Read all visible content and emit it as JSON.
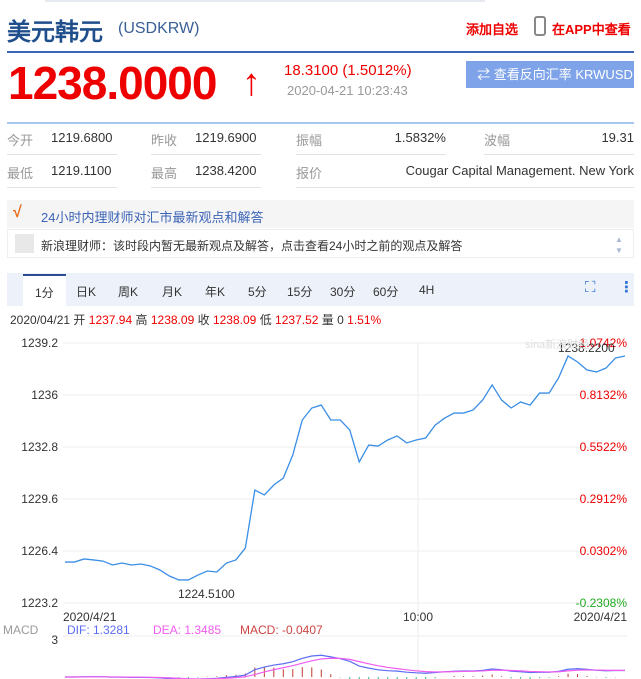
{
  "header": {
    "title": "美元韩元",
    "code": "(USDKRW)",
    "add_fav": "添加自选",
    "view_in_app": "在APP中查看"
  },
  "quote": {
    "price": "1238.0000",
    "change": "18.3100 (1.5012%)",
    "time": "2020-04-21 10:23:43",
    "reverse_button": "⇄ 查看反向汇率 KRWUSD"
  },
  "stats": [
    {
      "label": "今开",
      "value": "1219.6800"
    },
    {
      "label": "昨收",
      "value": "1219.6900"
    },
    {
      "label": "振幅",
      "value": "1.5832%"
    },
    {
      "label": "波幅",
      "value": "19.31"
    },
    {
      "label": "最低",
      "value": "1219.1100"
    },
    {
      "label": "最高",
      "value": "1238.4200"
    },
    {
      "label": "报价",
      "value": "Cougar Capital Management. New York"
    }
  ],
  "advisor": {
    "title": "24小时内理财师对汇市最新观点和解答",
    "message": "新浪理财师：该时段内暂无最新观点及解答，点击查看24小时之前的观点及解答"
  },
  "tabs": [
    "1分",
    "日K",
    "周K",
    "月K",
    "年K",
    "5分",
    "15分",
    "30分",
    "60分",
    "4H"
  ],
  "ohlc": {
    "date": "2020/04/21",
    "open_label": "开",
    "open": "1237.94",
    "high_label": "高",
    "high": "1238.09",
    "close_label": "收",
    "close": "1238.09",
    "low_label": "低",
    "low": "1237.52",
    "vol_label": "量",
    "vol": "0",
    "pct": "1.51%"
  },
  "colors": {
    "up": "#ee0000",
    "down": "#22aa22",
    "line": "#3a8ee6",
    "dif": "#5b6cf5",
    "dea": "#f05cf0"
  },
  "chart_data": {
    "type": "line",
    "y_ticks": [
      "1239.2",
      "1236",
      "1232.8",
      "1229.6",
      "1226.4",
      "1223.2"
    ],
    "pct_ticks": [
      "1.0742%",
      "0.8132%",
      "0.5522%",
      "0.2912%",
      "0.0302%",
      "-0.2308%"
    ],
    "x_ticks": [
      "2020/4/21",
      "10:00",
      "2020/4/21"
    ],
    "ylim": [
      1223.2,
      1239.2
    ],
    "max_label": "1238.2200",
    "min_label": "1224.5100",
    "values": [
      1225.72,
      1225.72,
      1225.91,
      1225.85,
      1225.78,
      1225.54,
      1225.66,
      1225.54,
      1225.6,
      1225.48,
      1225.23,
      1224.86,
      1224.62,
      1224.62,
      1224.92,
      1225.17,
      1225.11,
      1225.66,
      1225.85,
      1226.58,
      1230.15,
      1229.85,
      1230.46,
      1230.89,
      1232.31,
      1234.46,
      1235.2,
      1235.38,
      1234.46,
      1234.46,
      1233.85,
      1231.88,
      1232.92,
      1232.86,
      1233.23,
      1233.48,
      1233.05,
      1233.23,
      1233.35,
      1234.15,
      1234.58,
      1234.89,
      1234.89,
      1235.08,
      1235.69,
      1236.62,
      1235.69,
      1235.2,
      1235.57,
      1235.38,
      1236.12,
      1236.12,
      1237.05,
      1238.4,
      1238.03,
      1237.54,
      1237.42,
      1237.66,
      1238.28,
      1238.4
    ],
    "macd": {
      "label": "MACD",
      "dif_label": "DIF: 1.3281",
      "dea_label": "DEA: 1.3485",
      "macd_label": "MACD: -0.0407",
      "y_tick": "3"
    }
  }
}
